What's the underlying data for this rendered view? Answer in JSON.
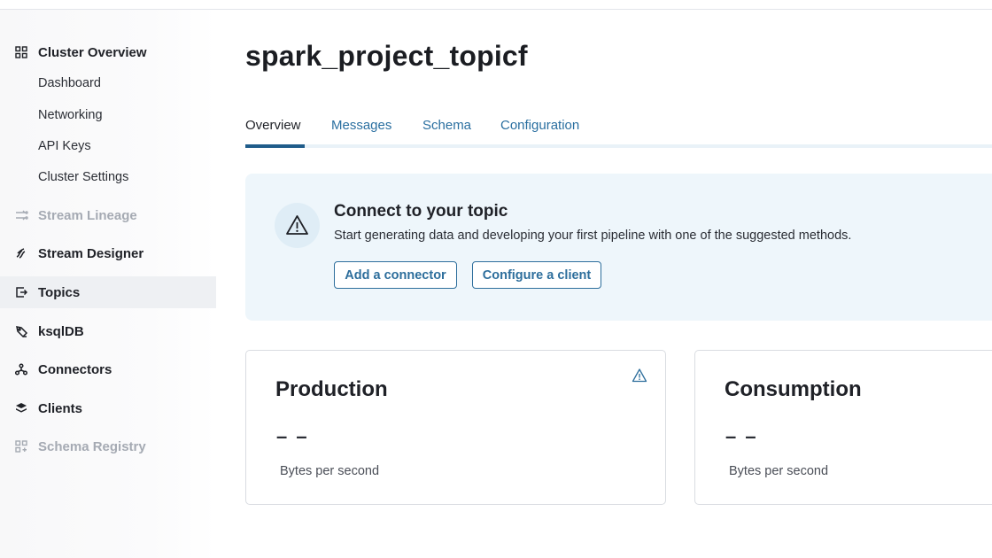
{
  "sidebar": {
    "cluster_overview": "Cluster Overview",
    "sub_items": [
      "Dashboard",
      "Networking",
      "API Keys",
      "Cluster Settings"
    ],
    "stream_lineage": "Stream Lineage",
    "stream_designer": "Stream Designer",
    "topics": "Topics",
    "ksqldb": "ksqlDB",
    "connectors": "Connectors",
    "clients": "Clients",
    "schema_registry": "Schema Registry"
  },
  "main": {
    "title": "spark_project_topicf",
    "tabs": [
      "Overview",
      "Messages",
      "Schema",
      "Configuration"
    ],
    "active_tab": "Overview"
  },
  "banner": {
    "title": "Connect to your topic",
    "text": "Start generating data and developing your first pipeline with one of the suggested methods.",
    "add_connector": "Add a connector",
    "configure_client": "Configure a client"
  },
  "cards": {
    "production": {
      "title": "Production",
      "value": "– –",
      "unit": "Bytes per second"
    },
    "consumption": {
      "title": "Consumption",
      "value": "– –",
      "unit": "Bytes per second"
    }
  },
  "colors": {
    "accent": "#2d6e9c",
    "tab_active_underline": "#1f5c8a",
    "banner_bg": "#eef6fb"
  }
}
